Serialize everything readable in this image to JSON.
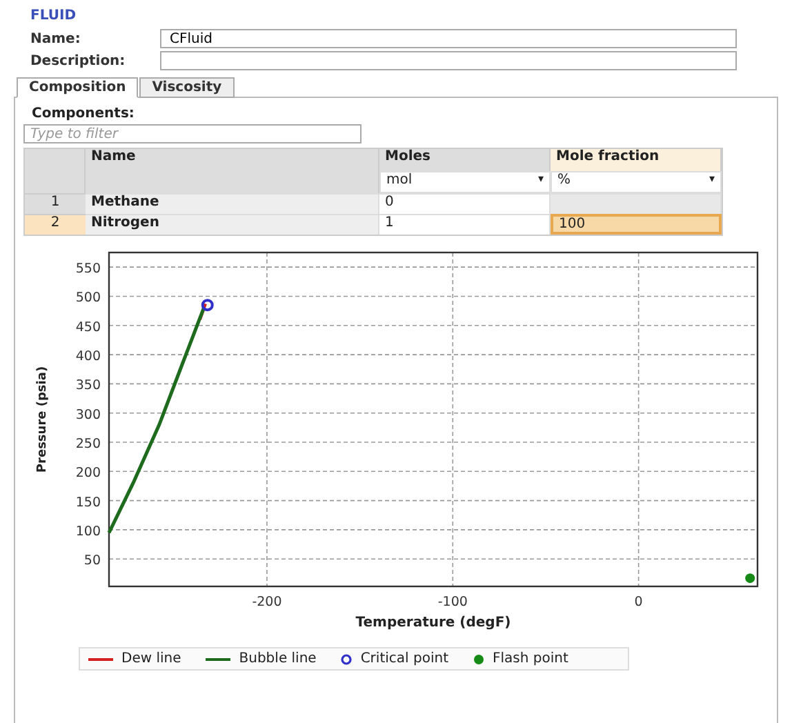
{
  "header": {
    "title": "FLUID",
    "fields": [
      {
        "label": "Name:",
        "value": "CFluid"
      },
      {
        "label": "Description:"
      }
    ]
  },
  "tabs": [
    {
      "label": "Composition",
      "selected": true
    },
    {
      "label": "Viscosity",
      "selected": false
    }
  ],
  "components": {
    "label": "Components:",
    "filter": {
      "placeholder": "Type to filter"
    },
    "table": {
      "columns": [
        {
          "title": "Name"
        },
        {
          "title": "Moles",
          "unit": "mol",
          "caret": "▾"
        },
        {
          "title": "Mole fraction",
          "unit": "%",
          "caret": "▾"
        }
      ],
      "rows": [
        {
          "index": "1",
          "name": "Methane",
          "moles": "0",
          "fraction": "",
          "selected": false
        },
        {
          "index": "2",
          "name": "Nitrogen",
          "moles": "1",
          "fraction": "100",
          "selected": true
        }
      ]
    }
  },
  "chart_data": {
    "type": "line",
    "grid": true,
    "xlabel": "Temperature (degF)",
    "ylabel": "Pressure (psia)",
    "xlim": [
      -285,
      64
    ],
    "ylim": [
      3,
      575
    ],
    "xticks": [
      -200,
      -100,
      0
    ],
    "yticks": [
      50,
      100,
      150,
      200,
      250,
      300,
      350,
      400,
      450,
      500,
      550
    ],
    "series": [
      {
        "name": "Dew line",
        "color": "#d42020",
        "x": [
          -236,
          -233
        ],
        "values": [
          460,
          487
        ]
      },
      {
        "name": "Bubble line",
        "color": "#1e6b1e",
        "x": [
          -285,
          -272,
          -258,
          -246,
          -234
        ],
        "values": [
          95,
          180,
          280,
          380,
          480
        ]
      },
      {
        "name": "Critical point",
        "color": "#3030c8",
        "marker": "open-circle",
        "x": [
          -232
        ],
        "values": [
          485
        ]
      },
      {
        "name": "Flash point",
        "color": "#168a16",
        "marker": "filled-circle",
        "x": [
          60
        ],
        "values": [
          17
        ]
      }
    ]
  }
}
